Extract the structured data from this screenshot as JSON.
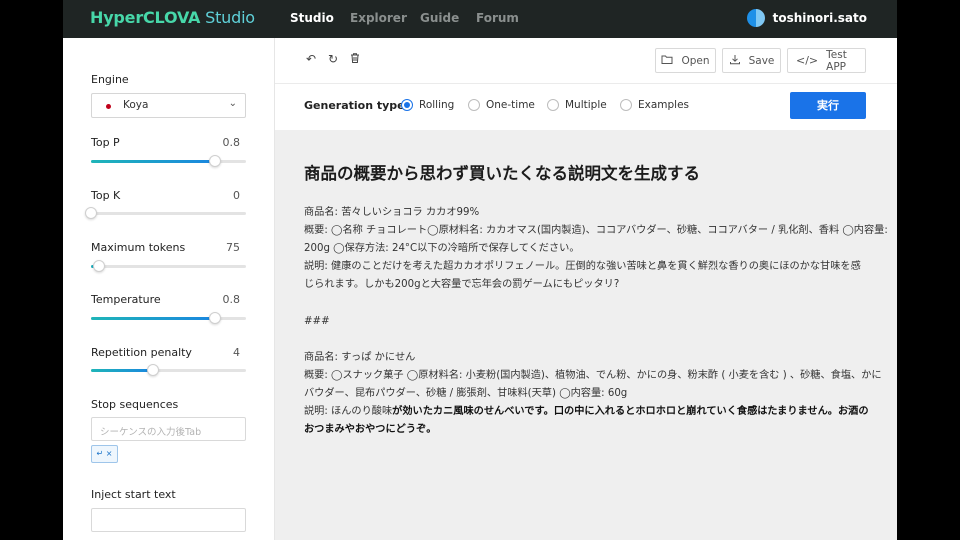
{
  "header": {
    "logo_primary": "HyperCLOVA",
    "logo_secondary": " Studio",
    "nav": [
      "Studio",
      "Explorer",
      "Guide",
      "Forum"
    ],
    "username": "toshinori.sato"
  },
  "sidebar": {
    "engine_label": "Engine",
    "engine_value": "Koya",
    "sliders": [
      {
        "label": "Top P",
        "value": "0.8",
        "fraction": 0.8
      },
      {
        "label": "Top K",
        "value": "0",
        "fraction": 0.0
      },
      {
        "label": "Maximum tokens",
        "value": "75",
        "fraction": 0.05
      },
      {
        "label": "Temperature",
        "value": "0.8",
        "fraction": 0.8
      },
      {
        "label": "Repetition penalty",
        "value": "4",
        "fraction": 0.4
      }
    ],
    "stop_label": "Stop sequences",
    "stop_placeholder": "シーケンスの入力後Tab",
    "stop_chip": "↵ ×",
    "inject_label": "Inject start text"
  },
  "toolbar": {
    "open_label": "Open",
    "save_label": "Save",
    "test_label": "Test APP"
  },
  "generation": {
    "label": "Generation type",
    "options": [
      "Rolling",
      "One-time",
      "Multiple",
      "Examples"
    ],
    "selected": "Rolling",
    "run_label": "実行"
  },
  "editor": {
    "title": "商品の概要から思わず買いたくなる説明文を生成する",
    "lines": [
      "商品名: 苦々しいショコラ カカオ99%",
      "概要: ◯名称 チョコレート◯原材料名: カカオマス(国内製造)、ココアバウダー、砂糖、ココアバター / 乳化剤、香料 ◯内容量:",
      "200g ◯保存方法: 24°C以下の冷暗所で保存してください。",
      "説明: 健康のことだけを考えた超カカオポリフェノール。圧倒的な強い苦味と鼻を貫く鮮烈な香りの奥にほのかな甘味を感",
      "じられます。しかも200gと大容量で忘年会の罰ゲームにもピッタリ?",
      "",
      "###",
      "",
      "商品名: すっぱ かにせん",
      "概要: ◯スナック菓子 ◯原材料名: 小麦粉(国内製造)、植物油、でん粉、かにの身、粉末酢 ( 小麦を含む ) 、砂糖、食塩、かに",
      "バウダー、昆布パウダー、砂糖 / 膨張剤、甘味料(天草) ◯内容量: 60g"
    ],
    "gen_prefix": "説明: ほんのり酸味",
    "gen_bold": "が効いたカニ風味のせんべいです。口の中に入れるとホロホロと崩れていく食感はたまりません。お酒の",
    "gen_bold_2": "おつまみやおやつにどうぞ。"
  }
}
